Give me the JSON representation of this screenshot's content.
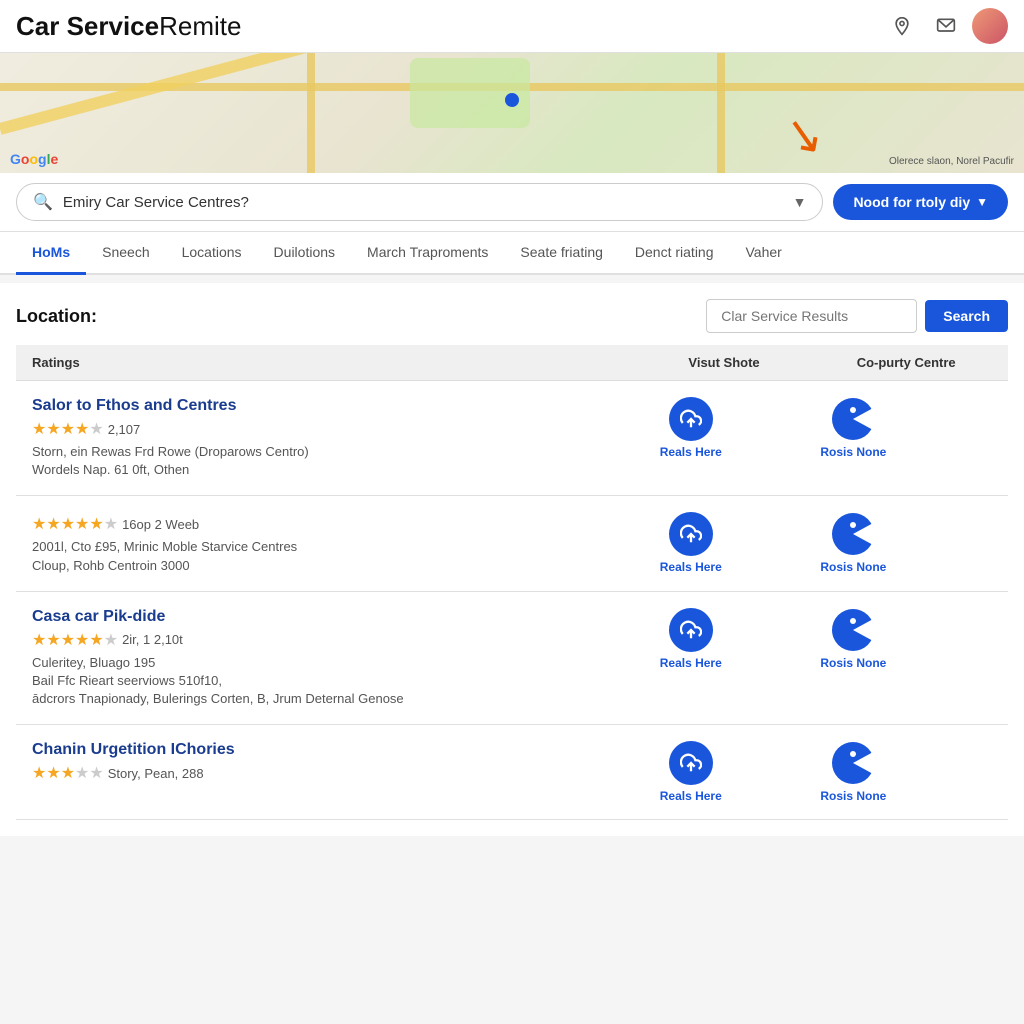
{
  "header": {
    "title_bold": "Car Service",
    "title_light": "Remite",
    "icons": [
      "location-pin",
      "message",
      "avatar"
    ]
  },
  "search": {
    "placeholder": "Emiry Car Service Centres?",
    "need_button": "Nood for rtoly diy"
  },
  "nav": {
    "tabs": [
      "HoMs",
      "Sneech",
      "Locations",
      "Duilotions",
      "March Traproments",
      "Seate friating",
      "Denct riating",
      "Vaher"
    ],
    "active_index": 0
  },
  "map": {
    "copyright": "Olerece slaon, Norel Pacufir"
  },
  "location_section": {
    "label": "Location:",
    "clear_placeholder": "Clar Service Results",
    "search_btn": "Search"
  },
  "table": {
    "headers": [
      "Ratings",
      "Visut Shote",
      "Co-purty Centre"
    ],
    "rows": [
      {
        "name": "Salor to Fthos and Centres",
        "stars": 4,
        "max_stars": 5,
        "rating_count": "2,107",
        "address_lines": [
          "Storn, ein Rewas Frd Rowe (Droparows Centro)",
          "Wordels Nap. 61 0ft, Othen"
        ],
        "action1_label": "Reals Here",
        "action2_label": "Rosis None"
      },
      {
        "name": "",
        "stars": 5,
        "max_stars": 6,
        "rating_count": "16op 2 Weeb",
        "address_lines": [
          "2001l, Cto £95, Mrinic Moble Starvice Centres",
          "Cloup, Rohb Centroin 3000"
        ],
        "action1_label": "Reals Here",
        "action2_label": "Rosis None"
      },
      {
        "name": "Casa car Pik-dide",
        "stars": 5,
        "max_stars": 6,
        "rating_count": "2ir, 1 2,10t",
        "address_lines": [
          "Culeritey, Bluago 195",
          "Bail Ffc Rieart seerviows 510f10,",
          "ādcrors Tnapionady, Bulerings Corten, B, Jrum Deternal Genose"
        ],
        "action1_label": "Reals Here",
        "action2_label": "Rosis None"
      },
      {
        "name": "Chanin Urgetition IChories",
        "stars": 3,
        "max_stars": 5,
        "rating_count": "Story, Pean, 288",
        "address_lines": [],
        "action1_label": "Reals Here",
        "action2_label": "Rosis None"
      }
    ]
  }
}
